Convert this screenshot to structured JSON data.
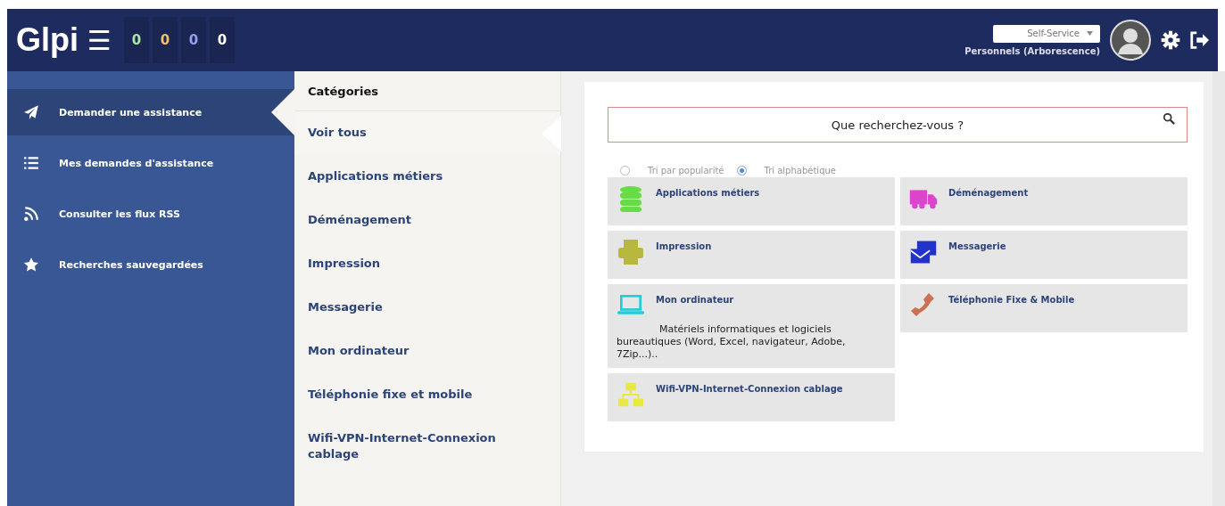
{
  "header": {
    "logo": "Glpi",
    "menu_icon": "☰",
    "counters": [
      {
        "value": "0",
        "color": "#a8e6a8"
      },
      {
        "value": "0",
        "color": "#f0c070"
      },
      {
        "value": "0",
        "color": "#9a9ef0"
      },
      {
        "value": "0",
        "color": "#ffffff"
      }
    ],
    "profile": "Self-Service",
    "entity": "Personnels (Arborescence)"
  },
  "sidebar": {
    "items": [
      {
        "label": "Demander une assistance",
        "kind": "plane",
        "selected": true
      },
      {
        "label": "Mes demandes d'assistance",
        "kind": "list",
        "selected": false
      },
      {
        "label": "Consulter les flux RSS",
        "kind": "rss",
        "selected": false
      },
      {
        "label": "Recherches sauvegardées",
        "kind": "star",
        "selected": false
      }
    ]
  },
  "categories": {
    "title": "Catégories",
    "items": [
      {
        "label": "Voir tous",
        "selected": true
      },
      {
        "label": "Applications métiers",
        "selected": false
      },
      {
        "label": "Déménagement",
        "selected": false
      },
      {
        "label": "Impression",
        "selected": false
      },
      {
        "label": "Messagerie",
        "selected": false
      },
      {
        "label": "Mon ordinateur",
        "selected": false
      },
      {
        "label": "Téléphonie fixe et mobile",
        "selected": false
      },
      {
        "label": "Wifi-VPN-Internet-Connexion cablage",
        "selected": false
      }
    ]
  },
  "search": {
    "placeholder": "Que recherchez-vous ?"
  },
  "sort_options": [
    {
      "label": "Tri par popularité",
      "selected": false
    },
    {
      "label": "Tri alphabétique",
      "selected": true
    }
  ],
  "tiles": [
    {
      "title": "Applications métiers",
      "kind": "database",
      "color": "#66dd44"
    },
    {
      "title": "Déménagement",
      "kind": "truck",
      "color": "#dd44cc"
    },
    {
      "title": "Impression",
      "kind": "printer",
      "color": "#b8b840"
    },
    {
      "title": "Messagerie",
      "kind": "envelopes",
      "color": "#2233cc"
    },
    {
      "title": "Mon ordinateur",
      "description": "Matériels informatiques et logiciels bureautiques (Word, Excel, navigateur, Adobe, 7Zip...)..",
      "kind": "laptop",
      "color": "#22ccdd"
    },
    {
      "title": "Téléphonie Fixe & Mobile",
      "kind": "phone",
      "color": "#cc7050"
    },
    {
      "title": "Wifi-VPN-Internet-Connexion cablage",
      "kind": "network",
      "color": "#e8e840"
    }
  ]
}
